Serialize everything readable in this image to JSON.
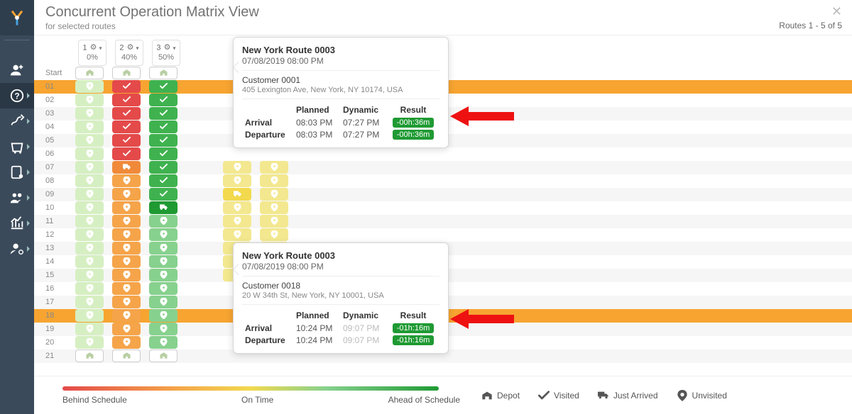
{
  "header": {
    "title": "Concurrent Operation Matrix View",
    "subtitle": "for selected routes",
    "routes_counter": "Routes 1 - 5 of 5"
  },
  "columns": [
    {
      "num": "1",
      "pct": "0%"
    },
    {
      "num": "2",
      "pct": "40%"
    },
    {
      "num": "3",
      "pct": "50%"
    }
  ],
  "row_labels": [
    "Start",
    "01",
    "02",
    "03",
    "04",
    "05",
    "06",
    "07",
    "08",
    "09",
    "10",
    "11",
    "12",
    "13",
    "14",
    "15",
    "16",
    "17",
    "18",
    "19",
    "20",
    "21"
  ],
  "highlight_rows": [
    1,
    18
  ],
  "matrix": [
    {
      "cells": [
        {
          "c": "white",
          "i": "depot"
        },
        {
          "c": "verylight",
          "i": "pin"
        },
        {
          "c": "verylight",
          "i": "pin"
        },
        {
          "c": "verylight",
          "i": "pin"
        },
        {
          "c": "verylight",
          "i": "pin"
        },
        {
          "c": "verylight",
          "i": "pin"
        },
        {
          "c": "verylight",
          "i": "pin"
        },
        {
          "c": "verylight",
          "i": "pin"
        },
        {
          "c": "verylight",
          "i": "pin"
        },
        {
          "c": "verylight",
          "i": "pin"
        },
        {
          "c": "verylight",
          "i": "pin"
        },
        {
          "c": "verylight",
          "i": "pin"
        },
        {
          "c": "verylight",
          "i": "pin"
        },
        {
          "c": "verylight",
          "i": "pin"
        },
        {
          "c": "verylight",
          "i": "pin"
        },
        {
          "c": "verylight",
          "i": "pin"
        },
        {
          "c": "verylight",
          "i": "pin"
        },
        {
          "c": "verylight",
          "i": "pin"
        },
        {
          "c": "verylight",
          "i": "pin"
        },
        {
          "c": "verylight",
          "i": "pin"
        },
        {
          "c": "verylight",
          "i": "pin"
        },
        {
          "c": "white",
          "i": "depot"
        }
      ]
    },
    {
      "cells": [
        {
          "c": "white",
          "i": "depot"
        },
        {
          "c": "red",
          "i": "check"
        },
        {
          "c": "red",
          "i": "check"
        },
        {
          "c": "red",
          "i": "check"
        },
        {
          "c": "red",
          "i": "check"
        },
        {
          "c": "red",
          "i": "check"
        },
        {
          "c": "red",
          "i": "check"
        },
        {
          "c": "darkorange",
          "i": "truck"
        },
        {
          "c": "orange",
          "i": "pin"
        },
        {
          "c": "orange",
          "i": "pin"
        },
        {
          "c": "orange",
          "i": "pin"
        },
        {
          "c": "orange",
          "i": "pin"
        },
        {
          "c": "orange",
          "i": "pin"
        },
        {
          "c": "orange",
          "i": "pin"
        },
        {
          "c": "orange",
          "i": "pin"
        },
        {
          "c": "orange",
          "i": "pin"
        },
        {
          "c": "orange",
          "i": "pin"
        },
        {
          "c": "orange",
          "i": "pin"
        },
        {
          "c": "orange",
          "i": "pin"
        },
        {
          "c": "orange",
          "i": "pin"
        },
        {
          "c": "orange",
          "i": "pin"
        },
        {
          "c": "white",
          "i": "depot"
        }
      ]
    },
    {
      "cells": [
        {
          "c": "white",
          "i": "depot"
        },
        {
          "c": "green",
          "i": "check"
        },
        {
          "c": "green",
          "i": "check"
        },
        {
          "c": "green",
          "i": "check"
        },
        {
          "c": "green",
          "i": "check"
        },
        {
          "c": "green",
          "i": "check"
        },
        {
          "c": "green",
          "i": "check"
        },
        {
          "c": "green",
          "i": "check"
        },
        {
          "c": "green",
          "i": "check"
        },
        {
          "c": "green",
          "i": "check"
        },
        {
          "c": "darkgreen",
          "i": "truck"
        },
        {
          "c": "lightgreen",
          "i": "pin"
        },
        {
          "c": "lightgreen",
          "i": "pin"
        },
        {
          "c": "lightgreen",
          "i": "pin"
        },
        {
          "c": "lightgreen",
          "i": "pin"
        },
        {
          "c": "lightgreen",
          "i": "pin"
        },
        {
          "c": "lightgreen",
          "i": "pin"
        },
        {
          "c": "lightgreen",
          "i": "pin"
        },
        {
          "c": "lightgreen",
          "i": "pin"
        },
        {
          "c": "lightgreen",
          "i": "pin"
        },
        {
          "c": "lightgreen",
          "i": "pin"
        },
        {
          "c": "white",
          "i": "depot"
        }
      ]
    }
  ],
  "extra_columns": [
    {
      "cells": [
        {
          "c": "lightyellow",
          "i": "pin"
        },
        {
          "c": "lightyellow",
          "i": "pin"
        },
        {
          "c": "yellow",
          "i": "truck"
        },
        {
          "c": "lightyellow",
          "i": "pin"
        },
        {
          "c": "lightyellow",
          "i": "pin"
        },
        {
          "c": "lightyellow",
          "i": "pin"
        },
        {
          "c": "lightyellow",
          "i": "pin"
        },
        {
          "c": "lightyellow",
          "i": "pin"
        },
        {
          "c": "lightyellow",
          "i": "pin"
        }
      ]
    },
    {
      "cells": [
        {
          "c": "lightyellow",
          "i": "pin"
        },
        {
          "c": "lightyellow",
          "i": "pin"
        },
        {
          "c": "lightyellow",
          "i": "pin"
        },
        {
          "c": "lightyellow",
          "i": "pin"
        },
        {
          "c": "lightyellow",
          "i": "pin"
        },
        {
          "c": "lightyellow",
          "i": "pin"
        },
        {
          "c": "lightyellow",
          "i": "pin"
        },
        {
          "c": "lightyellow",
          "i": "pin"
        },
        {
          "c": "lightyellow",
          "i": "pin"
        }
      ]
    }
  ],
  "tooltip1": {
    "route": "New York Route 0003",
    "datetime": "07/08/2019 08:00 PM",
    "customer": "Customer 0001",
    "address": "405 Lexington Ave, New York, NY 10174, USA",
    "headers": {
      "planned": "Planned",
      "dynamic": "Dynamic",
      "result": "Result"
    },
    "arrival_label": "Arrival",
    "departure_label": "Departure",
    "arrival": {
      "planned": "08:03 PM",
      "dynamic": "07:27 PM",
      "result": "-00h:36m"
    },
    "departure": {
      "planned": "08:03 PM",
      "dynamic": "07:27 PM",
      "result": "-00h:36m"
    }
  },
  "tooltip2": {
    "route": "New York Route 0003",
    "datetime": "07/08/2019 08:00 PM",
    "customer": "Customer 0018",
    "address": "20 W 34th St, New York, NY 10001, USA",
    "headers": {
      "planned": "Planned",
      "dynamic": "Dynamic",
      "result": "Result"
    },
    "arrival_label": "Arrival",
    "departure_label": "Departure",
    "arrival": {
      "planned": "10:24 PM",
      "dynamic": "09:07 PM",
      "result": "-01h:16m"
    },
    "departure": {
      "planned": "10:24 PM",
      "dynamic": "09:07 PM",
      "result": "-01h:16m"
    }
  },
  "legend": {
    "behind": "Behind Schedule",
    "ontime": "On Time",
    "ahead": "Ahead of Schedule",
    "depot": "Depot",
    "visited": "Visited",
    "just_arrived": "Just Arrived",
    "unvisited": "Unvisited"
  }
}
